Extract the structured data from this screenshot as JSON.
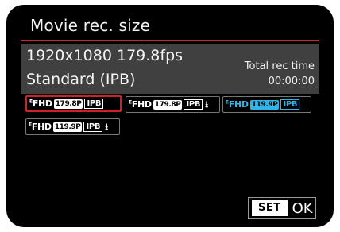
{
  "screen": {
    "title": "Movie rec. size"
  },
  "info": {
    "resolution_line": "1920x1080 179.8fps",
    "compression_line": "Standard (IPB)",
    "total_rec_label": "Total rec time",
    "total_rec_value": "00:00:00"
  },
  "options": [
    {
      "fhd": "FHD",
      "rate": "179.8P",
      "codec": "IPB",
      "suffix": "",
      "selected": true,
      "color": "#ffffff"
    },
    {
      "fhd": "FHD",
      "rate": "179.8P",
      "codec": "IPB",
      "suffix": "light",
      "selected": false,
      "color": "#ffffff"
    },
    {
      "fhd": "FHD",
      "rate": "119.9P",
      "codec": "IPB",
      "suffix": "",
      "selected": false,
      "color": "#2fb6e8"
    },
    {
      "fhd": "FHD",
      "rate": "119.9P",
      "codec": "IPB",
      "suffix": "light",
      "selected": false,
      "color": "#ffffff"
    }
  ],
  "footer": {
    "set_key": "SET",
    "ok_label": "OK"
  },
  "colors": {
    "accent_red": "#c8282e",
    "info_bg": "#404040",
    "blue": "#2fb6e8"
  }
}
